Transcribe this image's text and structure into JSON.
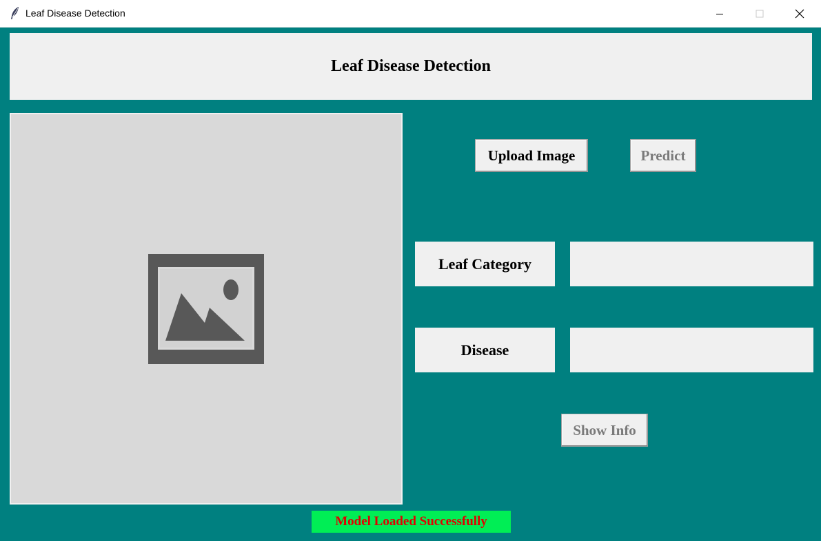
{
  "window": {
    "title": "Leaf Disease Detection",
    "icon": "feather-icon",
    "controls": [
      "minimize-icon",
      "maximize-icon",
      "close-icon"
    ]
  },
  "header": {
    "title": "Leaf Disease Detection"
  },
  "image_panel": {
    "icon": "image-placeholder-icon"
  },
  "buttons": {
    "upload_label": "Upload Image",
    "predict_label": "Predict",
    "show_info_label": "Show Info"
  },
  "fields": {
    "leaf_category_label": "Leaf Category",
    "leaf_category_value": "",
    "disease_label": "Disease",
    "disease_value": ""
  },
  "status": {
    "message": "Model Loaded Successfully"
  },
  "colors": {
    "background": "#008080",
    "panel": "#f0f0f0",
    "status_bg": "#00ee55",
    "status_text": "#e00000",
    "disabled_text": "#7a7a7a"
  }
}
